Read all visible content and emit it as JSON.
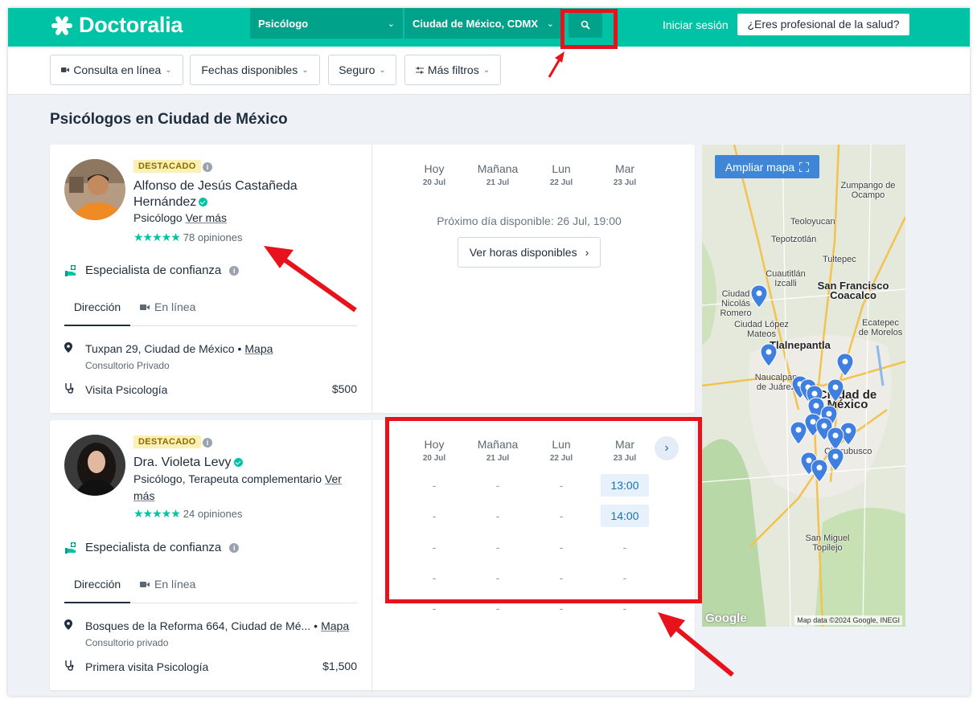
{
  "header": {
    "logo_text": "Doctoralia",
    "specialty_select": "Psicólogo",
    "city_select": "Ciudad de México, CDMX",
    "login_label": "Iniciar sesión",
    "pro_button": "¿Eres profesional de la salud?"
  },
  "filters": [
    {
      "label": "Consulta en línea",
      "icon": "video-icon"
    },
    {
      "label": "Fechas disponibles"
    },
    {
      "label": "Seguro"
    },
    {
      "label": "Más filtros",
      "icon": "sliders-icon"
    }
  ],
  "page_title": "Psicólogos en Ciudad de México",
  "calendar_days": [
    {
      "day": "Hoy",
      "date": "20 Jul"
    },
    {
      "day": "Mañana",
      "date": "21 Jul"
    },
    {
      "day": "Lun",
      "date": "22 Jul"
    },
    {
      "day": "Mar",
      "date": "23 Jul"
    }
  ],
  "doctors": [
    {
      "badge": "DESTACADO",
      "name_line1": "Alfonso de Jesús Castañeda",
      "name_line2": "Hernández",
      "specialty": "Psicólogo",
      "more_link": "Ver más",
      "stars": "★★★★★",
      "reviews": "78 opiniones",
      "trust": "Especialista de confianza",
      "tab_address": "Dirección",
      "tab_online": "En línea",
      "address": "Tuxpan 29, Ciudad de México",
      "map_link": "Mapa",
      "office": "Consultorio Privado",
      "service": "Visita Psicología",
      "price": "$500",
      "next_available": "Próximo día disponible: 26 Jul, 19:00",
      "hours_button": "Ver horas disponibles"
    },
    {
      "badge": "DESTACADO",
      "name_line1": "Dra. Violeta Levy",
      "specialty": "Psicólogo, Terapeuta complementario",
      "more_link_1": "Ver",
      "more_link_2": "más",
      "stars": "★★★★★",
      "reviews": "24 opiniones",
      "trust": "Especialista de confianza",
      "tab_address": "Dirección",
      "tab_online": "En línea",
      "address": "Bosques de la Reforma 664, Ciudad de Mé...",
      "map_link": "Mapa",
      "office": "Consultorio privado",
      "service": "Primera visita Psicología",
      "price": "$1,500",
      "slots": [
        [
          "-",
          "-",
          "-",
          "13:00"
        ],
        [
          "-",
          "-",
          "-",
          "14:00"
        ],
        [
          "-",
          "-",
          "-",
          "-"
        ],
        [
          "-",
          "-",
          "-",
          "-"
        ],
        [
          "-",
          "-",
          "-",
          "-"
        ]
      ]
    }
  ],
  "map": {
    "expand_button": "Ampliar mapa",
    "labels": [
      "Zumpango de Ocampo",
      "Teoloyucan",
      "Tepotzotlán",
      "Tultepec",
      "Cuautitlán Izcalli",
      "San Francisco Coacalco",
      "Ciudad Nicolás Romero",
      "Ciudad López Mateos",
      "Ecatepec de Morelos",
      "Tlalnepantla",
      "Naucalpan de Juárez",
      "Ciudad de México",
      "Churubusco",
      "San Miguel Topilejo"
    ],
    "attribution": "Map data ©2024 Google, INEGI",
    "google": "Google"
  },
  "colors": {
    "brand": "#00c3a5",
    "brand_dark": "#00a38a",
    "annotation": "#e8121c",
    "slot_bg": "#e6f1fb",
    "map_pin": "#3f7fe0"
  }
}
